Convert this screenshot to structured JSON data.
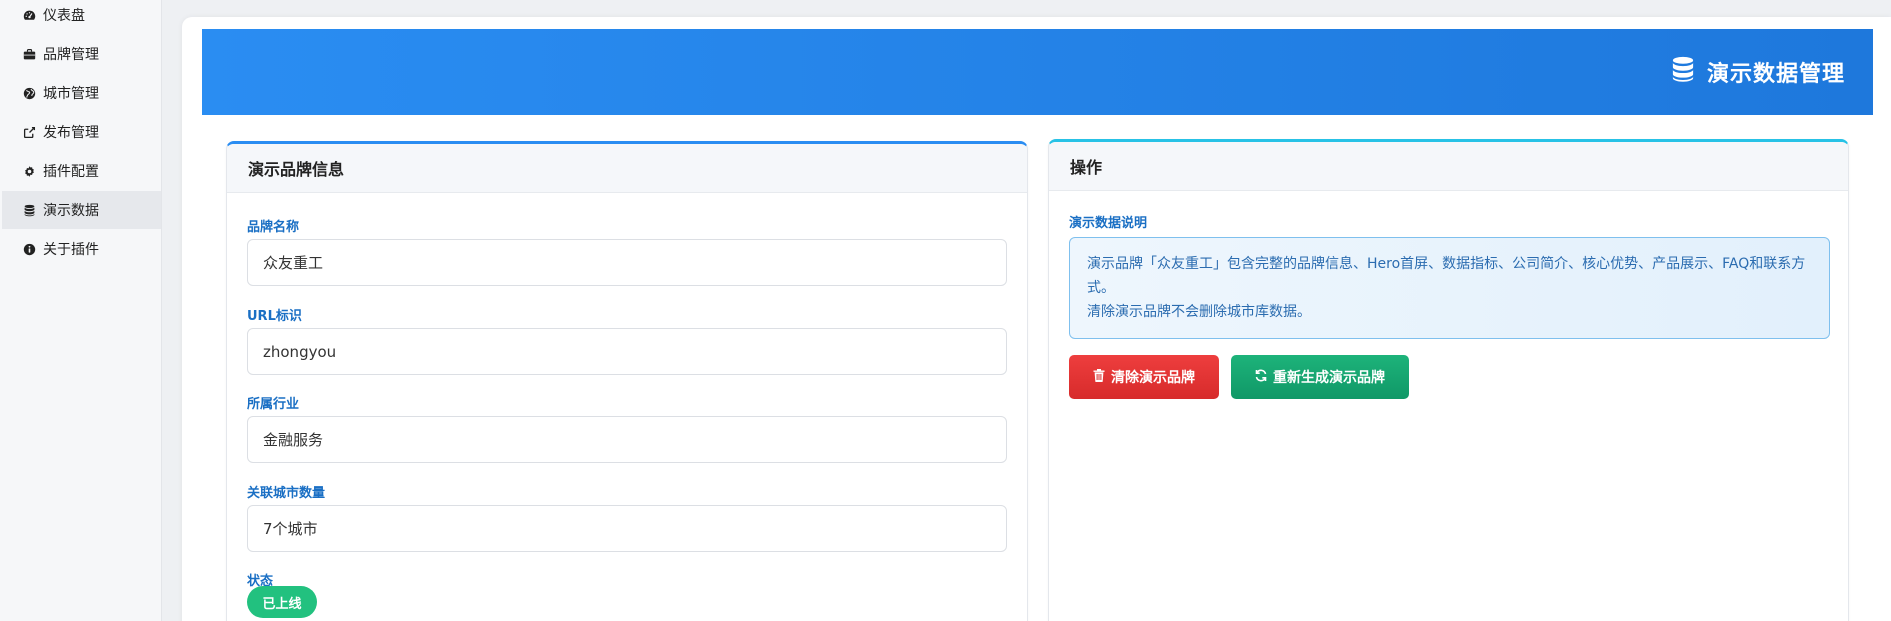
{
  "sidebar": {
    "items": [
      {
        "label": "仪表盘",
        "icon": "dashboard-icon"
      },
      {
        "label": "品牌管理",
        "icon": "briefcase-icon"
      },
      {
        "label": "城市管理",
        "icon": "globe-icon"
      },
      {
        "label": "发布管理",
        "icon": "share-icon"
      },
      {
        "label": "插件配置",
        "icon": "gear-icon"
      },
      {
        "label": "演示数据",
        "icon": "database-icon",
        "active": true
      },
      {
        "label": "关于插件",
        "icon": "info-icon"
      }
    ]
  },
  "banner": {
    "title": "演示数据管理",
    "icon": "database-icon"
  },
  "brand_card": {
    "title": "演示品牌信息",
    "fields": [
      {
        "label": "品牌名称",
        "value": "众友重工"
      },
      {
        "label": "URL标识",
        "value": "zhongyou"
      },
      {
        "label": "所属行业",
        "value": "金融服务"
      },
      {
        "label": "关联城市数量",
        "value": "7个城市"
      }
    ],
    "status_label": "状态",
    "status_value": "已上线"
  },
  "actions_card": {
    "title": "操作",
    "info_label": "演示数据说明",
    "info_line1": "演示品牌「众友重工」包含完整的品牌信息、Hero首屏、数据指标、公司简介、核心优势、产品展示、FAQ和联系方式。",
    "info_line2": "清除演示品牌不会删除城市库数据。",
    "clear_button": "清除演示品牌",
    "regen_button": "重新生成演示品牌"
  },
  "colors": {
    "accent": "#2a8df2",
    "danger": "#e33636",
    "success": "#15a56f",
    "status": "#22c17f"
  }
}
